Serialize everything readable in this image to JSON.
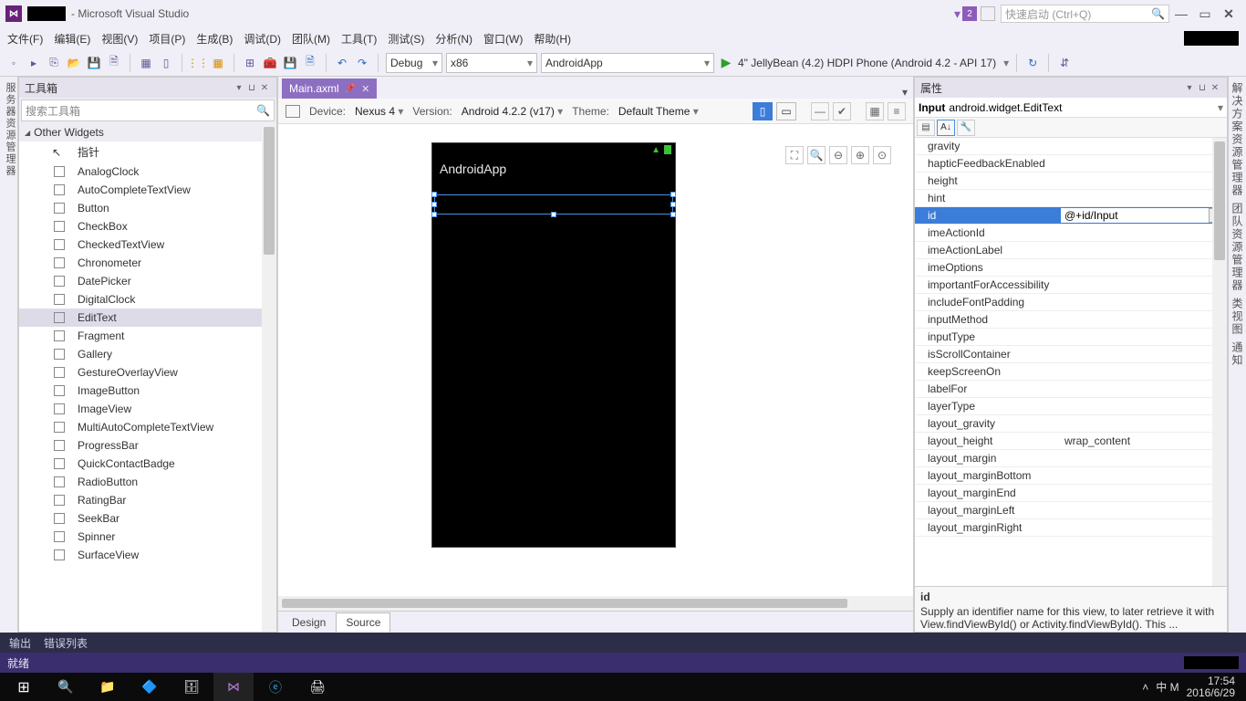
{
  "title_suffix": "- Microsoft Visual Studio",
  "notif_badge": "2",
  "quick_launch_placeholder": "快速启动 (Ctrl+Q)",
  "menu": [
    "文件(F)",
    "编辑(E)",
    "视图(V)",
    "项目(P)",
    "生成(B)",
    "调试(D)",
    "团队(M)",
    "工具(T)",
    "测试(S)",
    "分析(N)",
    "窗口(W)",
    "帮助(H)"
  ],
  "config_combo": "Debug",
  "platform_combo": "x86",
  "project_combo": "AndroidApp",
  "run_target": "4\" JellyBean (4.2) HDPI Phone (Android 4.2 - API 17)",
  "left_rail": "服务器资源管理器",
  "right_rail": [
    "解决方案资源管理器",
    "团队资源管理器",
    "类视图",
    "通知"
  ],
  "toolbox": {
    "title": "工具箱",
    "search_placeholder": "搜索工具箱",
    "category": "Other Widgets",
    "pointer": "指针",
    "items": [
      "AnalogClock",
      "AutoCompleteTextView",
      "Button",
      "CheckBox",
      "CheckedTextView",
      "Chronometer",
      "DatePicker",
      "DigitalClock",
      "EditText",
      "Fragment",
      "Gallery",
      "GestureOverlayView",
      "ImageButton",
      "ImageView",
      "MultiAutoCompleteTextView",
      "ProgressBar",
      "QuickContactBadge",
      "RadioButton",
      "RatingBar",
      "SeekBar",
      "Spinner",
      "SurfaceView"
    ],
    "selected": "EditText"
  },
  "editor": {
    "tab": "Main.axml",
    "device_label": "Device:",
    "device_value": "Nexus 4",
    "version_label": "Version:",
    "version_value": "Android 4.2.2 (v17)",
    "theme_label": "Theme:",
    "theme_value": "Default Theme",
    "app_title": "AndroidApp",
    "tabs": {
      "design": "Design",
      "source": "Source",
      "active": "Source"
    }
  },
  "properties": {
    "title": "属性",
    "obj_name": "Input",
    "obj_type": "android.widget.EditText",
    "rows": [
      {
        "n": "gravity",
        "v": ""
      },
      {
        "n": "hapticFeedbackEnabled",
        "v": ""
      },
      {
        "n": "height",
        "v": ""
      },
      {
        "n": "hint",
        "v": ""
      },
      {
        "n": "id",
        "v": "@+id/Input",
        "sel": true
      },
      {
        "n": "imeActionId",
        "v": ""
      },
      {
        "n": "imeActionLabel",
        "v": ""
      },
      {
        "n": "imeOptions",
        "v": ""
      },
      {
        "n": "importantForAccessibility",
        "v": ""
      },
      {
        "n": "includeFontPadding",
        "v": ""
      },
      {
        "n": "inputMethod",
        "v": ""
      },
      {
        "n": "inputType",
        "v": ""
      },
      {
        "n": "isScrollContainer",
        "v": ""
      },
      {
        "n": "keepScreenOn",
        "v": ""
      },
      {
        "n": "labelFor",
        "v": ""
      },
      {
        "n": "layerType",
        "v": ""
      },
      {
        "n": "layout_gravity",
        "v": ""
      },
      {
        "n": "layout_height",
        "v": "wrap_content"
      },
      {
        "n": "layout_margin",
        "v": ""
      },
      {
        "n": "layout_marginBottom",
        "v": ""
      },
      {
        "n": "layout_marginEnd",
        "v": ""
      },
      {
        "n": "layout_marginLeft",
        "v": ""
      },
      {
        "n": "layout_marginRight",
        "v": ""
      }
    ],
    "desc_title": "id",
    "desc_text": "Supply an identifier name for this view, to later retrieve it with View.findViewById() or Activity.findViewById(). This ..."
  },
  "bottom_tabs": [
    "输出",
    "错误列表"
  ],
  "status": "就绪",
  "clock": {
    "time": "17:54",
    "date": "2016/6/29"
  },
  "tray_text": "中 M"
}
